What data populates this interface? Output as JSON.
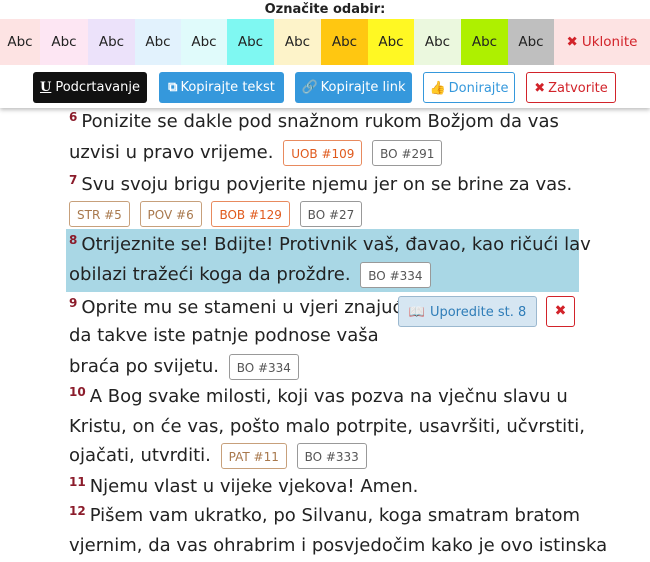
{
  "toolbar": {
    "title": "Označite odabir:",
    "swatches": [
      {
        "label": "Abc",
        "color": "#fde3e3"
      },
      {
        "label": "Abc",
        "color": "#fde6f3"
      },
      {
        "label": "Abc",
        "color": "#ece2fa"
      },
      {
        "label": "Abc",
        "color": "#e2f2fd"
      },
      {
        "label": "Abc",
        "color": "#e0fbfb"
      },
      {
        "label": "Abc",
        "color": "#7ff8f2"
      },
      {
        "label": "Abc",
        "color": "#fdf3c9"
      },
      {
        "label": "Abc",
        "color": "#ffc711"
      },
      {
        "label": "Abc",
        "color": "#fff823"
      },
      {
        "label": "Abc",
        "color": "#ebf8de"
      },
      {
        "label": "Abc",
        "color": "#aef000"
      },
      {
        "label": "Abc",
        "color": "#bfbfbf"
      }
    ],
    "remove_label": "Uklonite",
    "underline_label": "Podcrtavanje",
    "copy_text_label": "Kopirajte tekst",
    "copy_link_label": "Kopirajte link",
    "donate_label": "Donirajte",
    "close_label": "Zatvorite"
  },
  "verses": {
    "v6": {
      "num": "6",
      "line1": "Ponizite se dakle pod snažnom rukom Božjom da vas",
      "line2": "uzvisi u pravo vrijeme.",
      "refs": [
        "UOB #109",
        "BO #291"
      ]
    },
    "v7": {
      "num": "7",
      "line1": "Svu svoju brigu povjerite njemu jer on se brine za vas.",
      "refs": [
        "STR #5",
        "POV #6",
        "BOB #129",
        "BO #27"
      ]
    },
    "v8": {
      "num": "8",
      "line1": "Otrijeznite se! Bdijte! Protivnik vaš, đavao, kao ričući lav",
      "line2": "obilazi tražeći koga da proždre.",
      "refs": [
        "BO #334"
      ]
    },
    "v9": {
      "num": "9",
      "line1": "Oprite mu se stameni u vjeri znajući",
      "line2": "da takve iste patnje podnose vaša",
      "line3": "braća po svijetu.",
      "refs": [
        "BO #334"
      ]
    },
    "v10": {
      "num": "10",
      "line1": "A Bog svake milosti, koji vas pozva na vječnu slavu u",
      "line2": "Kristu, on će vas, pošto malo potrpite, usavršiti, učvrstiti,",
      "line3": "ojačati, utvrditi.",
      "refs": [
        "PAT #11",
        "BO #333"
      ]
    },
    "v11": {
      "num": "11",
      "line1": "Njemu vlast u vijeke vjekova! Amen."
    },
    "v12": {
      "num": "12",
      "line1": "Pišem vam ukratko, po Silvanu, koga smatram bratom",
      "line2": "vjernim, da vas ohrabrim i posvjedočim kako je ovo istinska"
    }
  },
  "compare": {
    "label": "Uporedite st. 8"
  }
}
